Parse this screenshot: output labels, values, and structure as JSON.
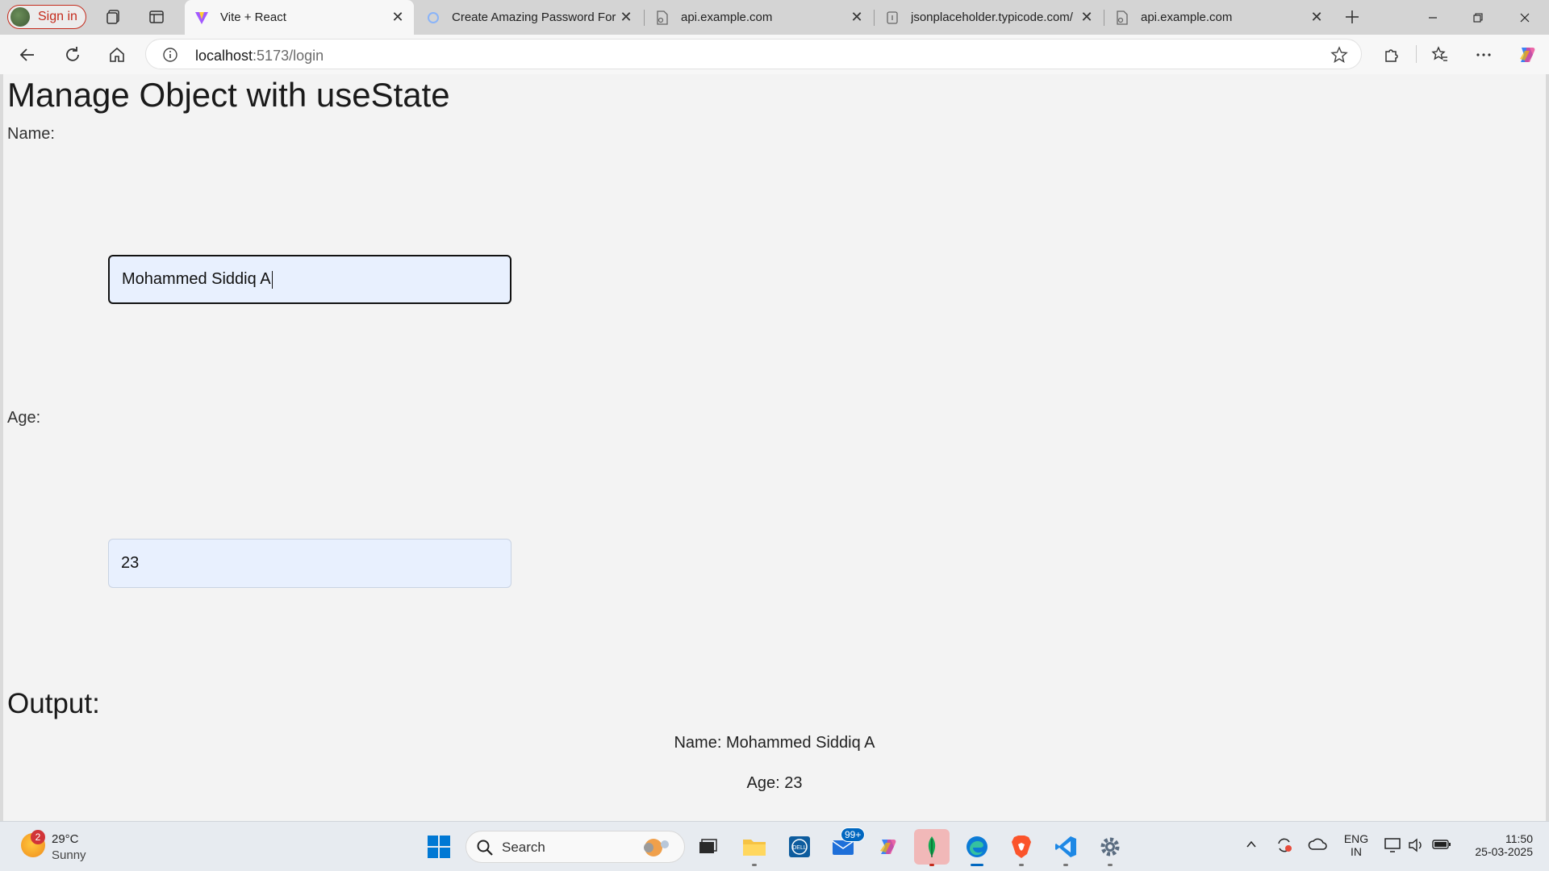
{
  "browser": {
    "signin_label": "Sign in",
    "tabs": [
      {
        "title": "Vite + React",
        "active": true
      },
      {
        "title": "Create Amazing Password Form",
        "active": false
      },
      {
        "title": "api.example.com",
        "active": false
      },
      {
        "title": "jsonplaceholder.typicode.com/",
        "active": false
      },
      {
        "title": "api.example.com",
        "active": false
      }
    ],
    "url_host": "localhost",
    "url_rest": ":5173/login"
  },
  "page": {
    "heading": "Manage Object with useState",
    "name_label": "Name:",
    "name_value": "Mohammed Siddiq A",
    "age_label": "Age:",
    "age_value": "23",
    "output_heading": "Output:",
    "output_name": "Name: Mohammed Siddiq A",
    "output_age": "Age: 23"
  },
  "taskbar": {
    "weather_badge": "2",
    "weather_temp": "29°C",
    "weather_desc": "Sunny",
    "search_label": "Search",
    "mail_badge": "99+",
    "lang_top": "ENG",
    "lang_bottom": "IN",
    "time": "11:50",
    "date": "25-03-2025"
  },
  "colors": {
    "accent": "#0067c0",
    "signin_red": "#c42b1c",
    "autofill_bg": "#e8f0fe"
  }
}
